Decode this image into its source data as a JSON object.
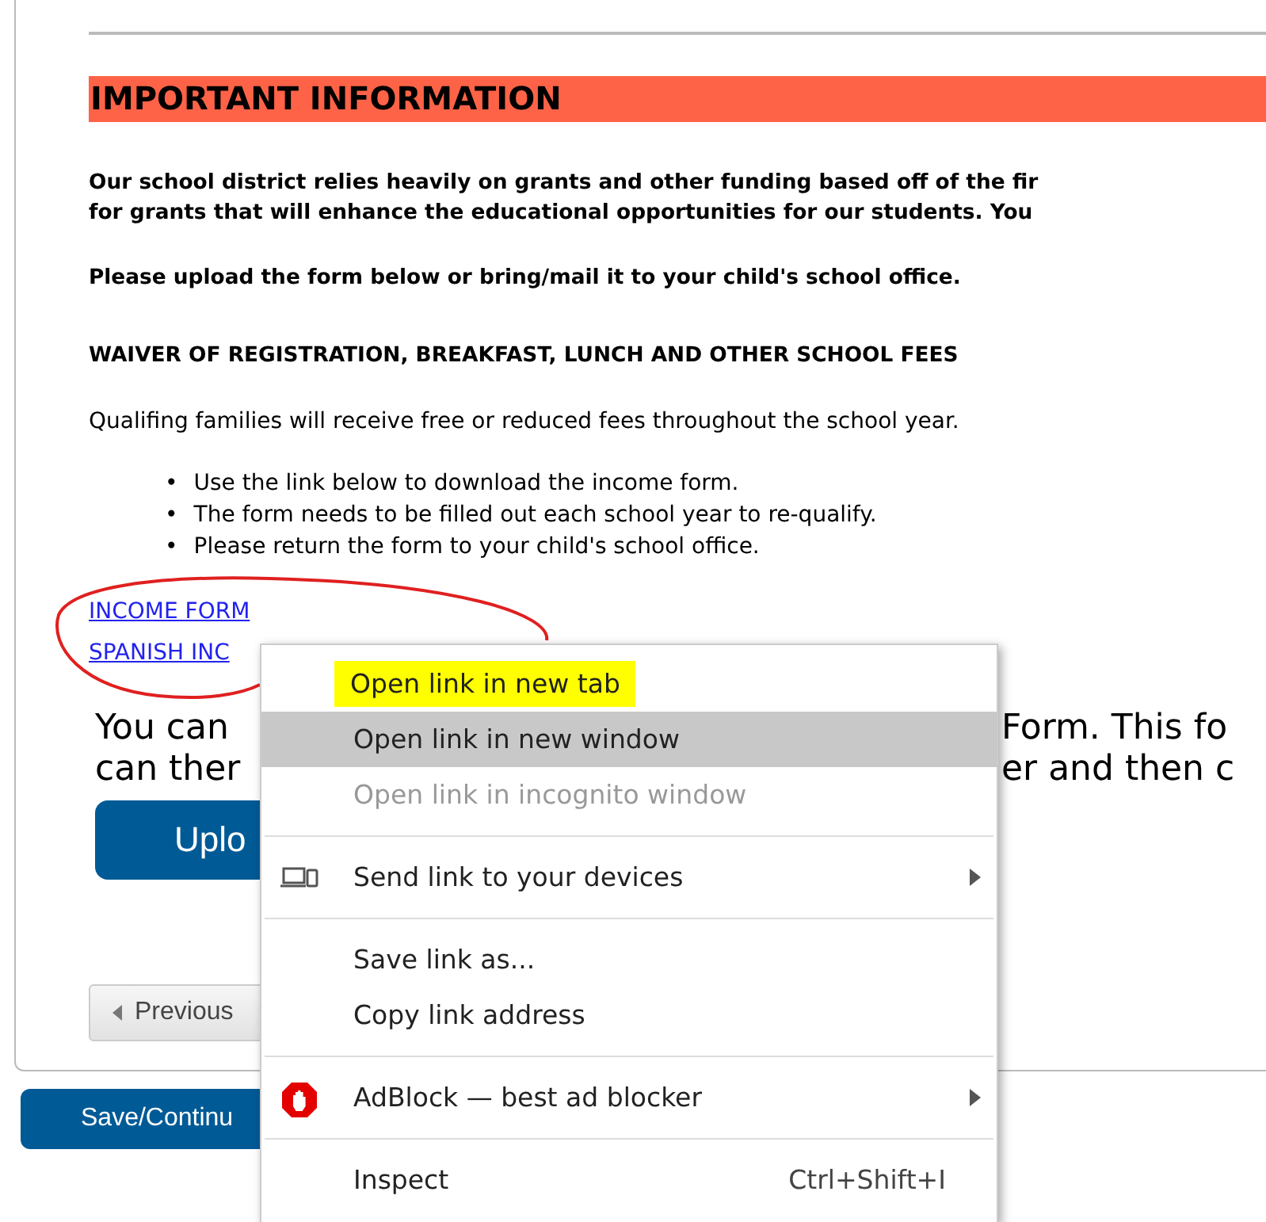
{
  "form": {
    "heading": "IMPORTANT INFORMATION",
    "intro_lines": [
      "Our school district relies heavily on grants and other funding based off of the fir",
      "for grants that will enhance the educational opportunities for our students. You"
    ],
    "upload_note": "Please upload the form below or bring/mail it to your child's school office.",
    "waiver_heading": "WAIVER OF REGISTRATION, BREAKFAST, LUNCH AND OTHER SCHOOL FEES",
    "waiver_text": "Qualifing families will receive free or reduced fees throughout the school year.",
    "bullets": [
      {
        "marker": "•",
        "text": "Use the link below to download the income form."
      },
      {
        "marker": "•",
        "text": "The form needs to be filled out each school year to re-qualify."
      },
      {
        "marker": "•",
        "text": "Please return the form to your child's school office."
      }
    ],
    "links": [
      {
        "label": "INCOME FORM"
      },
      {
        "label": "SPANISH INC"
      }
    ],
    "instruction_lines": [
      {
        "left": "You can",
        "right": "Form. This fo"
      },
      {
        "left": "can ther",
        "right": "er and then c"
      }
    ],
    "upload_button": "Uplo",
    "previous_button": "Previous"
  },
  "save_button": "Save/Continu",
  "context_menu": {
    "items": [
      {
        "kind": "item",
        "label": "Open link in new tab",
        "selected": false,
        "disabled": false,
        "highlighted": true,
        "submenu": false
      },
      {
        "kind": "item",
        "label": "Open link in new window",
        "selected": true,
        "disabled": false,
        "highlighted": false,
        "submenu": false
      },
      {
        "kind": "item",
        "label": "Open link in incognito window",
        "selected": false,
        "disabled": true,
        "highlighted": false,
        "submenu": false
      },
      {
        "kind": "separator"
      },
      {
        "kind": "device_item",
        "label": "Send link to your devices",
        "selected": false,
        "disabled": false,
        "highlighted": false,
        "submenu": true
      },
      {
        "kind": "separator"
      },
      {
        "kind": "item",
        "label": "Save link as...",
        "selected": false,
        "disabled": false,
        "highlighted": false,
        "submenu": false
      },
      {
        "kind": "item",
        "label": "Copy link address",
        "selected": false,
        "disabled": false,
        "highlighted": false,
        "submenu": false
      },
      {
        "kind": "separator"
      },
      {
        "kind": "extension_item",
        "label": "AdBlock — best ad blocker",
        "selected": false,
        "disabled": false,
        "highlighted": false,
        "submenu": true
      },
      {
        "kind": "separator"
      },
      {
        "kind": "item",
        "label": "Inspect",
        "shortcut": "Ctrl+Shift+I",
        "selected": false,
        "disabled": false,
        "highlighted": false,
        "submenu": false
      }
    ]
  }
}
